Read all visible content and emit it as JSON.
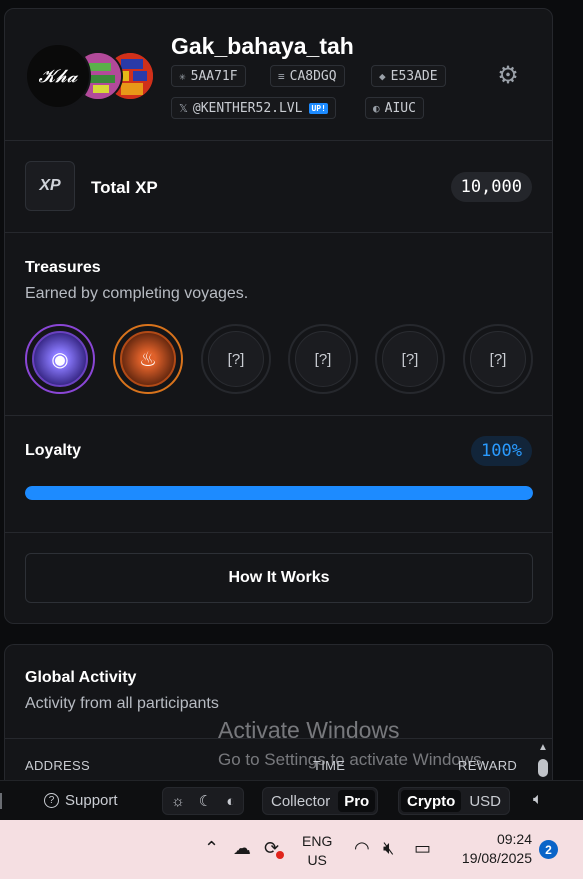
{
  "profile": {
    "username": "Gak_bahaya_tah",
    "chips": [
      {
        "icon": "✳",
        "label": "5AA71F"
      },
      {
        "icon": "≡",
        "label": "CA8DGQ"
      },
      {
        "icon": "◆",
        "label": "E53ADE"
      },
      {
        "icon": "𝕏",
        "label": "@KENTHER52.LVL",
        "badge": "UP!"
      },
      {
        "icon": "◐",
        "label": "AIUC"
      }
    ],
    "avatar_text": "𝓚𝓱𝓪"
  },
  "xp": {
    "logo": "XP",
    "label": "Total XP",
    "value": "10,000"
  },
  "treasures": {
    "title": "Treasures",
    "subtitle": "Earned by completing voyages.",
    "items": [
      {
        "state": "earned",
        "color": "purple",
        "glyph": "◉"
      },
      {
        "state": "earned",
        "color": "orange",
        "glyph": "♨"
      },
      {
        "state": "locked",
        "glyph": "[?]"
      },
      {
        "state": "locked",
        "glyph": "[?]"
      },
      {
        "state": "locked",
        "glyph": "[?]"
      },
      {
        "state": "locked",
        "glyph": "[?]"
      }
    ]
  },
  "loyalty": {
    "title": "Loyalty",
    "percent_label": "100%",
    "progress": 1.0
  },
  "how_it_works": {
    "label": "How It Works"
  },
  "activity": {
    "title": "Global Activity",
    "subtitle": "Activity from all participants",
    "columns": [
      "ADDRESS",
      "TIME",
      "REWARD"
    ]
  },
  "watermark": {
    "line1": "Activate Windows",
    "line2": "Go to Settings to activate Windows."
  },
  "appbar": {
    "support": "Support",
    "theme_options": [
      "☼",
      "☾",
      "◐"
    ],
    "mode_options": [
      "Collector",
      "Pro"
    ],
    "mode_selected": "Pro",
    "currency_options": [
      "Crypto",
      "USD"
    ],
    "currency_selected": "Crypto"
  },
  "taskbar": {
    "lang_line1": "ENG",
    "lang_line2": "US",
    "time": "09:24",
    "date": "19/08/2025",
    "notifications": "2"
  },
  "colors": {
    "accent": "#1d8bff",
    "bg": "#0b0c0e",
    "card": "#141518",
    "taskbar": "#f5dfe2"
  }
}
